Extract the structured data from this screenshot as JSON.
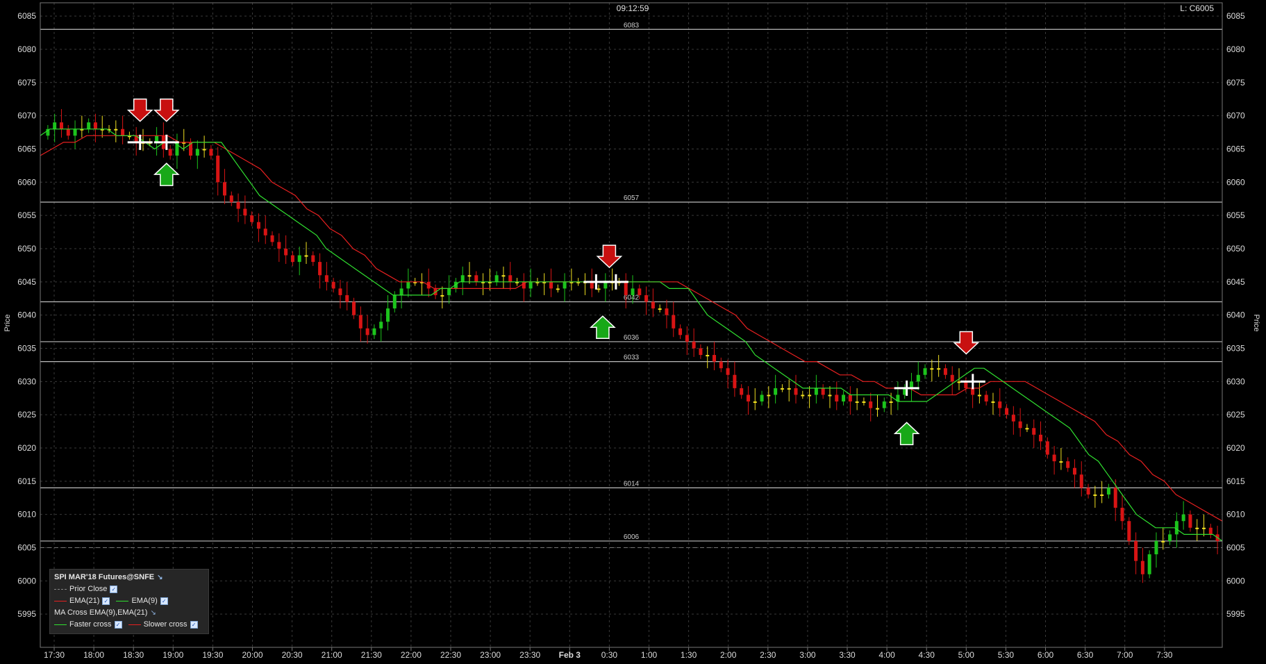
{
  "header": {
    "time": "09:12:59",
    "last": "L: C6005"
  },
  "axis": {
    "ylabel": "Price",
    "ylim": [
      5990,
      6087
    ],
    "yticks": [
      5995,
      6000,
      6005,
      6010,
      6015,
      6020,
      6025,
      6030,
      6035,
      6040,
      6045,
      6050,
      6055,
      6060,
      6065,
      6070,
      6075,
      6080,
      6085
    ]
  },
  "xaxis": {
    "labels": [
      "17:30",
      "18:00",
      "18:30",
      "19:00",
      "19:30",
      "20:00",
      "20:30",
      "21:00",
      "21:30",
      "22:00",
      "22:30",
      "23:00",
      "23:30",
      "Feb 3",
      "0:30",
      "1:00",
      "1:30",
      "2:00",
      "2:30",
      "3:00",
      "3:30",
      "4:00",
      "4:30",
      "5:00",
      "5:30",
      "6:00",
      "6:30",
      "7:00",
      "7:30"
    ]
  },
  "legend": {
    "title": "SPI MAR'18 Futures@SNFE",
    "prior_close": "Prior Close",
    "ema21": "EMA(21)",
    "ema9": "EMA(9)",
    "ma_cross": "MA Cross EMA(9),EMA(21)",
    "faster": "Faster cross",
    "slower": "Slower cross"
  },
  "colors": {
    "up": "#1cc41c",
    "down": "#d81414",
    "neutral": "#f0e020",
    "ema21": "#e82020",
    "ema9": "#30e030",
    "level": "#bdbdbd",
    "grid": "#3a3a3a"
  },
  "chart_data": {
    "type": "candlestick",
    "time_start": "17:15",
    "bar_minutes": 5,
    "prior_close": 6005,
    "levels": [
      6083,
      6057,
      6042,
      6036,
      6033,
      6014,
      6006
    ],
    "closes": [
      6068,
      6069,
      6068,
      6067,
      6068,
      6068,
      6069,
      6068,
      6068,
      6068,
      6068,
      6067,
      6067,
      6066,
      6066,
      6066,
      6067,
      6065,
      6064,
      6066,
      6066,
      6064,
      6065,
      6065,
      6064,
      6060,
      6058,
      6057,
      6056,
      6055,
      6054,
      6053,
      6052,
      6051,
      6050,
      6049,
      6048,
      6049,
      6049,
      6048,
      6046,
      6045,
      6044,
      6043,
      6042,
      6040,
      6038,
      6037,
      6038,
      6039,
      6041,
      6043,
      6044,
      6045,
      6045,
      6045,
      6044,
      6043,
      6043,
      6044,
      6045,
      6046,
      6046,
      6045,
      6045,
      6045,
      6046,
      6046,
      6045,
      6045,
      6044,
      6045,
      6045,
      6045,
      6044,
      6044,
      6045,
      6045,
      6045,
      6045,
      6044,
      6044,
      6045,
      6045,
      6045,
      6043,
      6044,
      6043,
      6042,
      6041,
      6041,
      6040,
      6038,
      6037,
      6036,
      6035,
      6034,
      6034,
      6033,
      6032,
      6031,
      6029,
      6028,
      6027,
      6027,
      6028,
      6028,
      6029,
      6029,
      6029,
      6028,
      6028,
      6028,
      6029,
      6028,
      6028,
      6027,
      6028,
      6027,
      6027,
      6027,
      6026,
      6026,
      6027,
      6027,
      6028,
      6029,
      6030,
      6031,
      6032,
      6032,
      6032,
      6031,
      6030,
      6030,
      6029,
      6028,
      6028,
      6027,
      6027,
      6026,
      6025,
      6024,
      6023,
      6023,
      6022,
      6021,
      6019,
      6018,
      6018,
      6017,
      6016,
      6014,
      6013,
      6013,
      6013,
      6014,
      6011,
      6009,
      6006,
      6003,
      6001,
      6004,
      6006,
      6006,
      6007,
      6009,
      6010,
      6008,
      6008,
      6008,
      6007,
      6006
    ],
    "ema9": [
      6067,
      6068,
      6068,
      6068,
      6068,
      6068,
      6068,
      6068,
      6067,
      6067,
      6067,
      6066,
      6065,
      6066,
      6066,
      6065,
      6066,
      6066,
      6066,
      6066,
      6064,
      6062,
      6060,
      6058,
      6057,
      6056,
      6055,
      6054,
      6053,
      6052,
      6050,
      6049,
      6048,
      6047,
      6046,
      6045,
      6044,
      6043,
      6043,
      6043,
      6043,
      6043,
      6044,
      6044,
      6045,
      6045,
      6045,
      6045,
      6045,
      6045,
      6045,
      6045,
      6045,
      6045,
      6045,
      6045,
      6045,
      6045,
      6045,
      6045,
      6045,
      6045,
      6045,
      6045,
      6045,
      6045,
      6044,
      6044,
      6044,
      6042,
      6040,
      6039,
      6038,
      6037,
      6036,
      6034,
      6033,
      6032,
      6031,
      6030,
      6029,
      6029,
      6029,
      6029,
      6029,
      6028,
      6028,
      6028,
      6028,
      6028,
      6027,
      6027,
      6027,
      6027,
      6028,
      6029,
      6030,
      6031,
      6032,
      6032,
      6031,
      6030,
      6029,
      6028,
      6027,
      6026,
      6025,
      6024,
      6023,
      6021,
      6019,
      6018,
      6016,
      6014,
      6012,
      6010,
      6009,
      6008,
      6008,
      6008,
      6007,
      6007,
      6007,
      6007,
      6006
    ],
    "ema21": [
      6064,
      6065,
      6066,
      6066,
      6067,
      6067,
      6067,
      6067,
      6067,
      6067,
      6067,
      6067,
      6066,
      6066,
      6066,
      6066,
      6065,
      6064,
      6063,
      6062,
      6060,
      6059,
      6058,
      6056,
      6055,
      6053,
      6052,
      6050,
      6049,
      6047,
      6046,
      6045,
      6045,
      6045,
      6044,
      6044,
      6044,
      6044,
      6044,
      6044,
      6044,
      6044,
      6045,
      6045,
      6045,
      6045,
      6045,
      6045,
      6045,
      6045,
      6045,
      6045,
      6045,
      6045,
      6045,
      6045,
      6044,
      6043,
      6042,
      6041,
      6040,
      6038,
      6037,
      6036,
      6035,
      6034,
      6033,
      6033,
      6032,
      6031,
      6031,
      6030,
      6030,
      6029,
      6029,
      6029,
      6028,
      6028,
      6028,
      6028,
      6029,
      6029,
      6030,
      6030,
      6030,
      6030,
      6029,
      6028,
      6027,
      6026,
      6025,
      6024,
      6022,
      6021,
      6019,
      6018,
      6016,
      6015,
      6013,
      6012,
      6011,
      6010,
      6009
    ],
    "signals": [
      {
        "type": "down",
        "time": "18:35",
        "price": 6070
      },
      {
        "type": "down",
        "time": "18:55",
        "price": 6070
      },
      {
        "type": "up",
        "time": "18:55",
        "price": 6062
      },
      {
        "type": "down",
        "time": "0:30",
        "price": 6048
      },
      {
        "type": "up",
        "time": "0:25",
        "price": 6039
      },
      {
        "type": "up",
        "time": "4:15",
        "price": 6023
      },
      {
        "type": "down",
        "time": "5:00",
        "price": 6035
      }
    ],
    "crosses": [
      {
        "time": "18:35",
        "price": 6066
      },
      {
        "time": "18:55",
        "price": 6066
      },
      {
        "time": "0:20",
        "price": 6045
      },
      {
        "time": "0:35",
        "price": 6045
      },
      {
        "time": "4:15",
        "price": 6029
      },
      {
        "time": "5:05",
        "price": 6030
      }
    ]
  }
}
